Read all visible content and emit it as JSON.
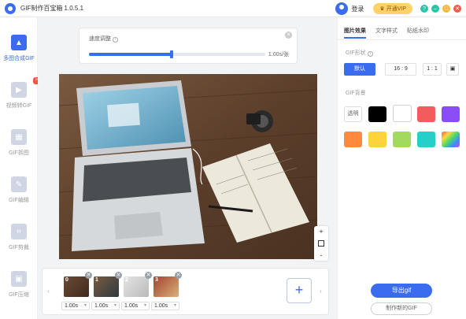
{
  "window": {
    "title": "GIF制作百宝箱 1.0.5.1",
    "login": "登录",
    "vip": "开通VIP",
    "controls": [
      {
        "name": "help",
        "glyph": "?",
        "color": "#26c6a6"
      },
      {
        "name": "minimize",
        "glyph": "–",
        "color": "#26c6a6"
      },
      {
        "name": "maximize",
        "glyph": "□",
        "color": "#f5b63a"
      },
      {
        "name": "close",
        "glyph": "✕",
        "color": "#f25a4a"
      }
    ]
  },
  "sidebar": {
    "items": [
      {
        "label": "多图合成GIF",
        "icon": "image-stack-icon",
        "active": true
      },
      {
        "label": "视频转GIF",
        "icon": "video-icon",
        "badge": "HOT"
      },
      {
        "label": "GIF拆图",
        "icon": "split-icon"
      },
      {
        "label": "GIF编辑",
        "icon": "edit-icon"
      },
      {
        "label": "GIF剪裁",
        "icon": "crop-icon"
      },
      {
        "label": "GIF压缩",
        "icon": "compress-icon"
      }
    ]
  },
  "speed": {
    "title": "速度调整",
    "value": "1.00s/张",
    "level": 0.47
  },
  "zoom": {
    "in": "+",
    "out": "-"
  },
  "frames": [
    {
      "index": "0",
      "delay": "1.00s"
    },
    {
      "index": "1",
      "delay": "1.00s"
    },
    {
      "index": "2",
      "delay": "1.00s"
    },
    {
      "index": "3",
      "delay": "1.00s"
    }
  ],
  "right_panel": {
    "tabs": [
      "图片效果",
      "文字样式",
      "贴纸水印"
    ],
    "shape_label": "GIF形状",
    "shapes": [
      "默认",
      "16 : 9",
      "1 : 1"
    ],
    "bg_label": "GIF背景",
    "transparent_label": "透明",
    "colors": [
      "#000000",
      "#ffffff",
      "#f25c5c",
      "#8a4cf5",
      "#ff8a3d",
      "#ffd43b",
      "#a3d95c",
      "#26d0c8"
    ],
    "export": "导出gif",
    "new_gif": "制作新的GIF"
  }
}
